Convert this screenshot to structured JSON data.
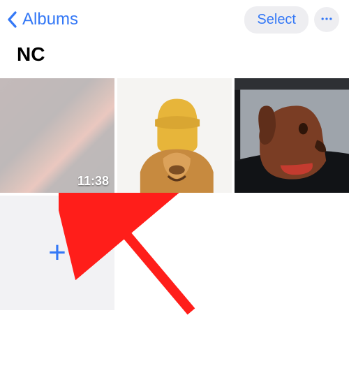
{
  "header": {
    "back_label": "Albums",
    "select_label": "Select"
  },
  "album": {
    "title": "NC"
  },
  "grid": {
    "items": [
      {
        "type": "video",
        "duration": "11:38"
      },
      {
        "type": "photo"
      },
      {
        "type": "photo"
      }
    ]
  },
  "icons": {
    "chevron_left": "chevron-left-icon",
    "more": "ellipsis-icon",
    "add": "plus-icon"
  }
}
